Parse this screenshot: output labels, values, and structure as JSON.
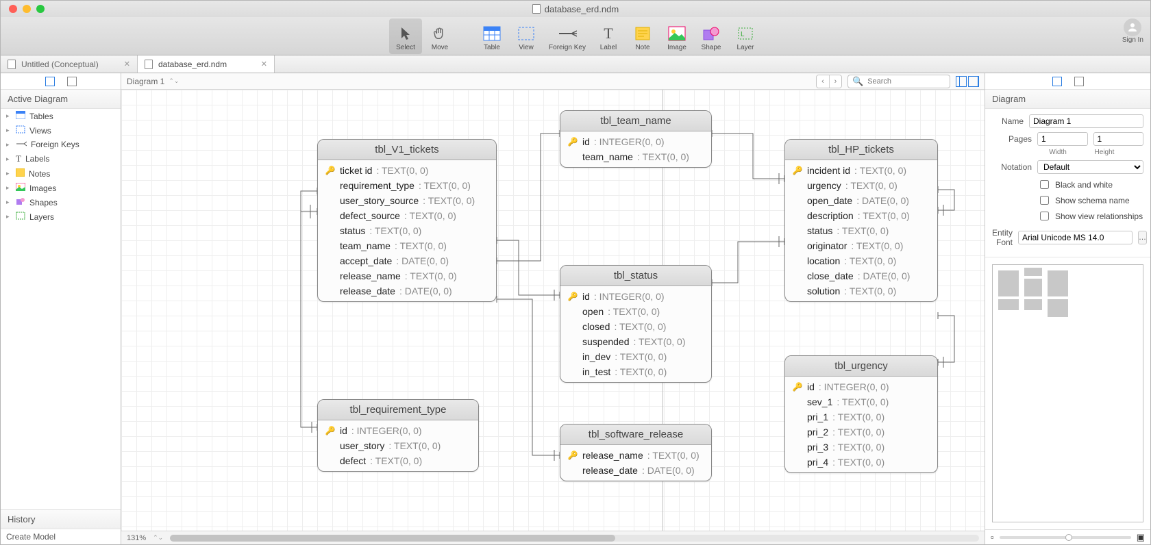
{
  "window": {
    "title": "database_erd.ndm"
  },
  "toolbar": {
    "select": "Select",
    "move": "Move",
    "table": "Table",
    "view": "View",
    "foreign_key": "Foreign Key",
    "label": "Label",
    "note": "Note",
    "image": "Image",
    "shape": "Shape",
    "layer": "Layer",
    "signin": "Sign In"
  },
  "tabs": [
    {
      "label": "Untitled (Conceptual)",
      "active": false
    },
    {
      "label": "database_erd.ndm",
      "active": true
    }
  ],
  "left": {
    "active_diagram_header": "Active Diagram",
    "items": [
      {
        "label": "Tables",
        "icon": "table"
      },
      {
        "label": "Views",
        "icon": "view"
      },
      {
        "label": "Foreign Keys",
        "icon": "fk"
      },
      {
        "label": "Labels",
        "icon": "label"
      },
      {
        "label": "Notes",
        "icon": "note"
      },
      {
        "label": "Images",
        "icon": "image"
      },
      {
        "label": "Shapes",
        "icon": "shape"
      },
      {
        "label": "Layers",
        "icon": "layer"
      }
    ],
    "history_header": "History",
    "history_items": [
      "Create Model"
    ]
  },
  "canvas": {
    "diagram_tab": "Diagram 1",
    "search_placeholder": "Search",
    "zoom": "131%",
    "entities": {
      "tbl_V1_tickets": {
        "title": "tbl_V1_tickets",
        "fields": [
          {
            "name": "ticket id",
            "type": "TEXT(0, 0)",
            "pk": true
          },
          {
            "name": "requirement_type",
            "type": "TEXT(0, 0)"
          },
          {
            "name": "user_story_source",
            "type": "TEXT(0, 0)"
          },
          {
            "name": "defect_source",
            "type": "TEXT(0, 0)"
          },
          {
            "name": "status",
            "type": "TEXT(0, 0)"
          },
          {
            "name": "team_name",
            "type": "TEXT(0, 0)"
          },
          {
            "name": "accept_date",
            "type": "DATE(0, 0)"
          },
          {
            "name": "release_name",
            "type": "TEXT(0, 0)"
          },
          {
            "name": "release_date",
            "type": "DATE(0, 0)"
          }
        ]
      },
      "tbl_team_name": {
        "title": "tbl_team_name",
        "fields": [
          {
            "name": "id",
            "type": "INTEGER(0, 0)",
            "pk": true
          },
          {
            "name": "team_name",
            "type": "TEXT(0, 0)"
          }
        ]
      },
      "tbl_HP_tickets": {
        "title": "tbl_HP_tickets",
        "fields": [
          {
            "name": "incident id",
            "type": "TEXT(0, 0)",
            "pk": true
          },
          {
            "name": "urgency",
            "type": "TEXT(0, 0)"
          },
          {
            "name": "open_date",
            "type": "DATE(0, 0)"
          },
          {
            "name": "description",
            "type": "TEXT(0, 0)"
          },
          {
            "name": "status",
            "type": "TEXT(0, 0)"
          },
          {
            "name": "originator",
            "type": "TEXT(0, 0)"
          },
          {
            "name": "location",
            "type": "TEXT(0, 0)"
          },
          {
            "name": "close_date",
            "type": "DATE(0, 0)"
          },
          {
            "name": "solution",
            "type": "TEXT(0, 0)"
          }
        ]
      },
      "tbl_status": {
        "title": "tbl_status",
        "fields": [
          {
            "name": "id",
            "type": "INTEGER(0, 0)",
            "pk": true
          },
          {
            "name": "open",
            "type": "TEXT(0, 0)"
          },
          {
            "name": "closed",
            "type": "TEXT(0, 0)"
          },
          {
            "name": "suspended",
            "type": "TEXT(0, 0)"
          },
          {
            "name": "in_dev",
            "type": "TEXT(0, 0)"
          },
          {
            "name": "in_test",
            "type": "TEXT(0, 0)"
          }
        ]
      },
      "tbl_requirement_type": {
        "title": "tbl_requirement_type",
        "fields": [
          {
            "name": "id",
            "type": "INTEGER(0, 0)",
            "pk": true
          },
          {
            "name": "user_story",
            "type": "TEXT(0, 0)"
          },
          {
            "name": "defect",
            "type": "TEXT(0, 0)"
          }
        ]
      },
      "tbl_software_release": {
        "title": "tbl_software_release",
        "fields": [
          {
            "name": "release_name",
            "type": "TEXT(0, 0)",
            "pk": true
          },
          {
            "name": "release_date",
            "type": "DATE(0, 0)"
          }
        ]
      },
      "tbl_urgency": {
        "title": "tbl_urgency",
        "fields": [
          {
            "name": "id",
            "type": "INTEGER(0, 0)",
            "pk": true
          },
          {
            "name": "sev_1",
            "type": "TEXT(0, 0)"
          },
          {
            "name": "pri_1",
            "type": "TEXT(0, 0)"
          },
          {
            "name": "pri_2",
            "type": "TEXT(0, 0)"
          },
          {
            "name": "pri_3",
            "type": "TEXT(0, 0)"
          },
          {
            "name": "pri_4",
            "type": "TEXT(0, 0)"
          }
        ]
      }
    }
  },
  "right": {
    "header": "Diagram",
    "labels": {
      "name": "Name",
      "pages": "Pages",
      "width": "Width",
      "height": "Height",
      "notation": "Notation",
      "entity_font": "Entity Font"
    },
    "name_value": "Diagram 1",
    "pages_width": "1",
    "pages_height": "1",
    "notation": "Default",
    "cb_bw": "Black and white",
    "cb_schema": "Show schema name",
    "cb_viewrel": "Show view relationships",
    "entity_font": "Arial Unicode MS 14.0"
  }
}
